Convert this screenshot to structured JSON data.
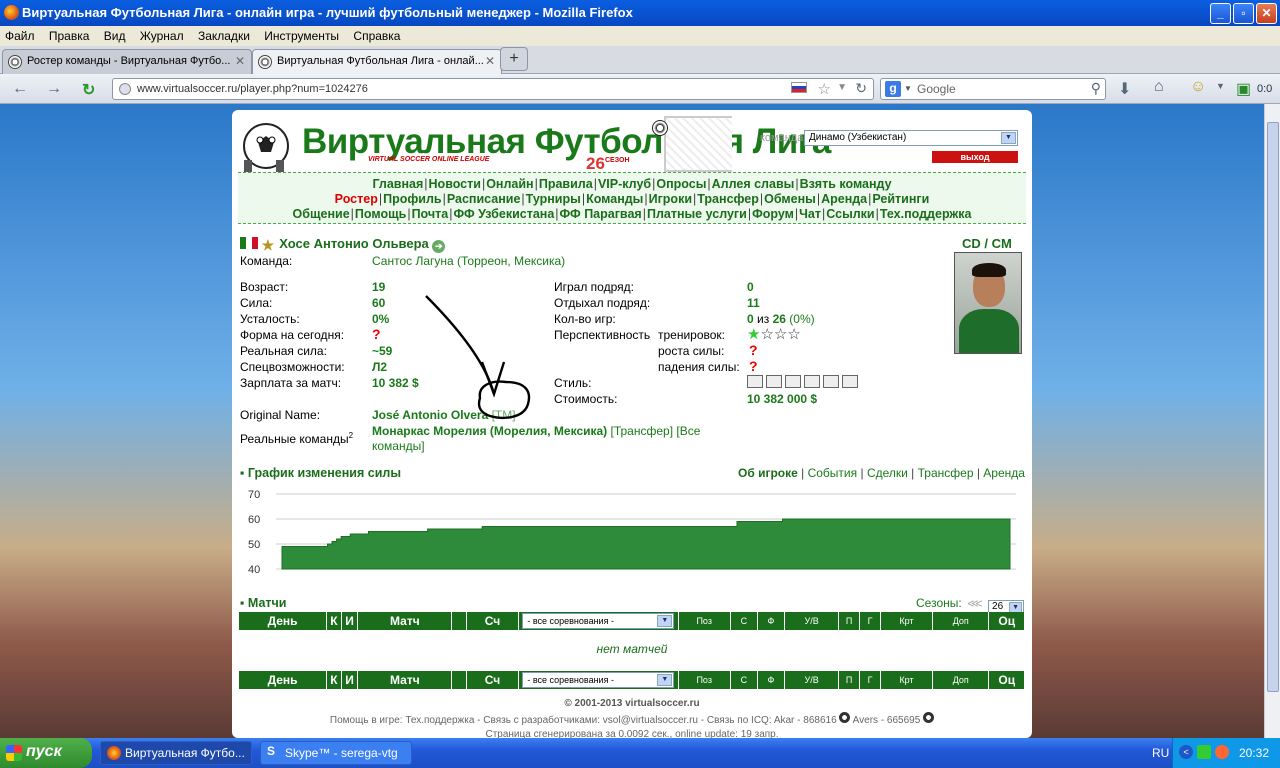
{
  "window": {
    "title": "Виртуальная Футбольная Лига - онлайн игра - лучший футбольный менеджер - Mozilla Firefox",
    "controls": {
      "minimize": "_",
      "maximize": "▫",
      "close": "✕"
    }
  },
  "menubar": [
    "Файл",
    "Правка",
    "Вид",
    "Журнал",
    "Закладки",
    "Инструменты",
    "Справка"
  ],
  "tabs": [
    {
      "label": "Ростер команды - Виртуальная Футбо...",
      "active": false
    },
    {
      "label": "Виртуальная Футбольная Лига - онлай...",
      "active": true
    }
  ],
  "newtab": "+",
  "nav": {
    "back": "←",
    "forward": "→",
    "reload_tab": "↻",
    "url": "www.virtualsoccer.ru/player.php?num=1024276",
    "search_placeholder": "Google",
    "download_count": "0:0"
  },
  "site": {
    "logo_title": "Виртуальная Футбольная Лига",
    "logo_sub": "VIRTUAL SOCCER ONLINE LEAGUE",
    "season_num": "26",
    "season_word": "СЕЗОН",
    "team_label": "команда",
    "team_value": "Динамо (Узбекистан)",
    "logout": "выход",
    "menu_rows": [
      [
        "Главная",
        "Новости",
        "Онлайн",
        "Правила",
        "VIP-клуб",
        "Опросы",
        "Аллея славы",
        "Взять команду"
      ],
      [
        "Ростер",
        "Профиль",
        "Расписание",
        "Турниры",
        "Команды",
        "Игроки",
        "Трансфер",
        "Обмены",
        "Аренда",
        "Рейтинги"
      ],
      [
        "Общение",
        "Помощь",
        "Почта",
        "ФФ Узбекистана",
        "ФФ Парагвая",
        "Платные услуги",
        "Форум",
        "Чат",
        "Ссылки",
        "Тех.поддержка"
      ]
    ],
    "menu_current": "Ростер"
  },
  "player": {
    "name": "Хосе Антонио Ольвера",
    "position": "CD / CM",
    "team_label": "Команда:",
    "team_value": "Сантос Лагуна (Торреон, Мексика)",
    "left": [
      {
        "label": "Возраст:",
        "value": "19"
      },
      {
        "label": "Сила:",
        "value": "60"
      },
      {
        "label": "Усталость:",
        "value": "0%"
      },
      {
        "label": "Форма на сегодня:",
        "value": "?"
      },
      {
        "label": "Реальная сила:",
        "value": "~59"
      },
      {
        "label": "Спецвозможности:",
        "value": "Л2"
      },
      {
        "label": "Зарплата за матч:",
        "value": "10 382 $"
      }
    ],
    "right": {
      "played_label": "Играл подряд:",
      "played_value": "0",
      "rested_label": "Отдыхал подряд:",
      "rested_value": "11",
      "games_label": "Кол-во игр:",
      "games_a": "0",
      "games_of": "из",
      "games_b": "26",
      "games_pct": "(0%)",
      "persp_label": "Перспективность",
      "training_label": "тренировок:",
      "growth_label": "роста силы:",
      "growth_value": "?",
      "fall_label": "падения силы:",
      "fall_value": "?",
      "training_stars": 1,
      "training_stars_max": 4,
      "style_label": "Стиль:",
      "cost_label": "Стоимость:",
      "cost_value": "10 382 000 $"
    },
    "original_label": "Original Name:",
    "original_value": "José Antonio Olvera",
    "original_tm": "[TM]",
    "real_teams_label": "Реальные команды",
    "real_teams_sup": "2",
    "real_teams_value": "Монаркас Морелия (Морелия, Мексика)",
    "real_teams_transfer": "[Трансфер]",
    "real_teams_all_1": "[Все",
    "real_teams_all_2": "команды]"
  },
  "chart_section": {
    "title": "График изменения силы",
    "links": [
      "Об игроке",
      "События",
      "Сделки",
      "Трансфер",
      "Аренда"
    ]
  },
  "chart_data": {
    "type": "area",
    "title": "График изменения силы",
    "xlabel": "",
    "ylabel": "",
    "ylim": [
      40,
      70
    ],
    "yticks": [
      70,
      60,
      50,
      40
    ],
    "grid": true,
    "series": [
      {
        "values": [
          49,
          49,
          49,
          49,
          49,
          49,
          49,
          49,
          49,
          49,
          50,
          51,
          52,
          53,
          53,
          54,
          54,
          54,
          54,
          55,
          55,
          55,
          55,
          55,
          55,
          55,
          55,
          55,
          55,
          55,
          55,
          55,
          56,
          56,
          56,
          56,
          56,
          56,
          56,
          56,
          56,
          56,
          56,
          56,
          57,
          57,
          57,
          57,
          57,
          57,
          57,
          57,
          57,
          57,
          57,
          57,
          57,
          57,
          57,
          57,
          57,
          57,
          57,
          57,
          57,
          57,
          57,
          57,
          57,
          57,
          57,
          57,
          57,
          57,
          57,
          57,
          57,
          57,
          57,
          57,
          57,
          57,
          57,
          57,
          57,
          57,
          57,
          57,
          57,
          57,
          57,
          57,
          57,
          57,
          57,
          57,
          57,
          57,
          57,
          57,
          59,
          59,
          59,
          59,
          59,
          59,
          59,
          59,
          59,
          59,
          60,
          60,
          60,
          60,
          60,
          60,
          60,
          60,
          60,
          60,
          60,
          60,
          60,
          60,
          60,
          60,
          60,
          60,
          60,
          60,
          60,
          60,
          60,
          60,
          60,
          60,
          60,
          60,
          60,
          60,
          60,
          60,
          60,
          60,
          60,
          60,
          60,
          60,
          60,
          60,
          60,
          60,
          60,
          60,
          60,
          60,
          60,
          60,
          60,
          60
        ]
      }
    ]
  },
  "matches": {
    "title": "Матчи",
    "seasons_label": "Сезоны:",
    "seasons_arrow": "⋘",
    "season_value": "26",
    "columns": [
      "День",
      "К",
      "И",
      "Матч",
      "",
      "Сч",
      "- все соревнования -",
      "Поз",
      "С",
      "Ф",
      "У/В",
      "П",
      "Г",
      "Крт",
      "Доп",
      "Оц"
    ],
    "empty": "нет матчей"
  },
  "footer": {
    "copyright": "© 2001-2013 virtualsoccer.ru",
    "help": "Помощь в игре: Тех.поддержка - Связь с разработчиками: vsol@virtualsoccer.ru - Связь по ICQ: Akar - 868616",
    "avers": "Avers - 665695",
    "gen": "Страница сгенерирована за 0.0092 сек., online update: 19 запр."
  },
  "taskbar": {
    "start": "пуск",
    "tasks": [
      "Виртуальная Футбо...",
      "Skype™ - serega-vtg"
    ],
    "lang": "RU",
    "clock": "20:32"
  },
  "colors": {
    "site_green": "#1a6d1a",
    "chart_fill": "#2e8b3a",
    "accent_red": "#cc1111"
  }
}
